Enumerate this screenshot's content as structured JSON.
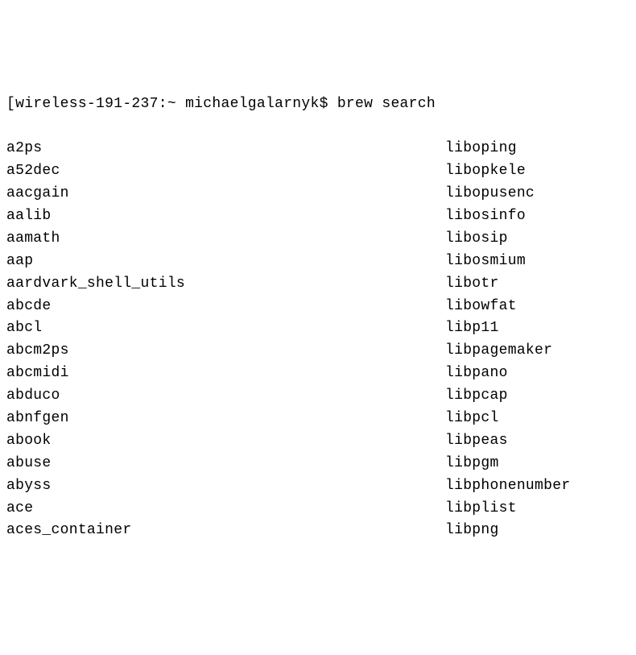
{
  "prompt": {
    "bracket_open": "[",
    "host": "wireless-191-237",
    "separator1": ":",
    "cwd": "~",
    "user": "michaelgalarnyk",
    "dollar": "$",
    "command": "brew search"
  },
  "left_column": [
    "a2ps",
    "a52dec",
    "aacgain",
    "aalib",
    "aamath",
    "aap",
    "aardvark_shell_utils",
    "abcde",
    "abcl",
    "abcm2ps",
    "abcmidi",
    "abduco",
    "abnfgen",
    "abook",
    "abuse",
    "abyss",
    "ace",
    "aces_container"
  ],
  "right_column": [
    "liboping",
    "libopkele",
    "libopusenc",
    "libosinfo",
    "libosip",
    "libosmium",
    "libotr",
    "libowfat",
    "libp11",
    "libpagemaker",
    "libpano",
    "libpcap",
    "libpcl",
    "libpeas",
    "libpgm",
    "libphonenumber",
    "libplist",
    "libpng"
  ]
}
